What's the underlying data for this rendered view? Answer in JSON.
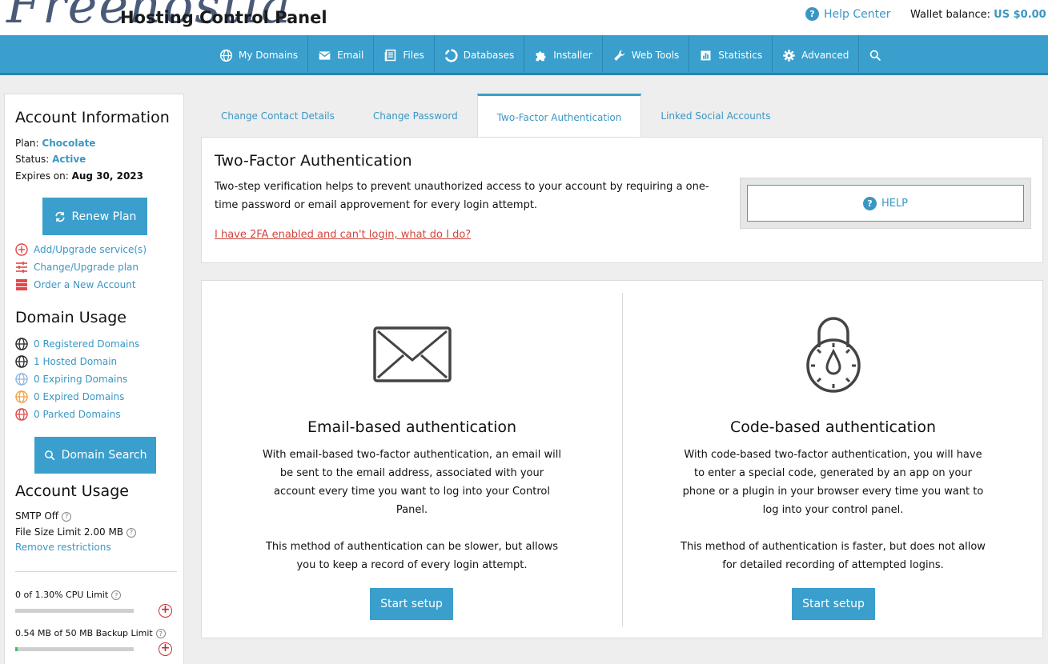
{
  "header": {
    "logo_script": "Freehostia",
    "logo_sub": "Hosting Control Panel",
    "help_center": "Help Center",
    "wallet_label": "Wallet balance:",
    "wallet_value": "US $0.00"
  },
  "nav": {
    "items": [
      {
        "label": "My Domains",
        "icon": "globe-icon"
      },
      {
        "label": "Email",
        "icon": "envelope-icon"
      },
      {
        "label": "Files",
        "icon": "files-icon"
      },
      {
        "label": "Databases",
        "icon": "database-icon"
      },
      {
        "label": "Installer",
        "icon": "puzzle-icon"
      },
      {
        "label": "Web Tools",
        "icon": "wrench-icon"
      },
      {
        "label": "Statistics",
        "icon": "chart-icon"
      },
      {
        "label": "Advanced",
        "icon": "gear-icon"
      }
    ],
    "search_icon": "search-icon"
  },
  "sidebar": {
    "account_info_title": "Account Information",
    "plan_label": "Plan:",
    "plan_value": "Chocolate",
    "status_label": "Status:",
    "status_value": "Active",
    "expires_label": "Expires on:",
    "expires_value": "Aug 30, 2023",
    "renew_button": "Renew Plan",
    "links": [
      "Add/Upgrade service(s)",
      "Change/Upgrade plan",
      "Order a New Account"
    ],
    "domain_usage_title": "Domain Usage",
    "domains": [
      {
        "label": "0 Registered Domains",
        "color": "#222222"
      },
      {
        "label": "1 Hosted Domain",
        "color": "#222222"
      },
      {
        "label": "0 Expiring Domains",
        "color": "#8fb6dc"
      },
      {
        "label": "0 Expired Domains",
        "color": "#f0a040"
      },
      {
        "label": "0 Parked Domains",
        "color": "#e04848"
      }
    ],
    "domain_search_button": "Domain Search",
    "account_usage_title": "Account Usage",
    "smtp": "SMTP Off",
    "file_size": "File Size Limit 2.00 MB",
    "remove_restrictions": "Remove restrictions",
    "cpu_limit": "0 of 1.30% CPU Limit",
    "cpu_fraction": 0.0,
    "backup_limit": "0.54 MB of 50 MB Backup Limit",
    "backup_fraction": 0.0108
  },
  "tabs": [
    {
      "label": "Change Contact Details",
      "active": false
    },
    {
      "label": "Change Password",
      "active": false
    },
    {
      "label": "Two-Factor Authentication",
      "active": true
    },
    {
      "label": "Linked Social Accounts",
      "active": false
    }
  ],
  "tfa": {
    "title": "Two-Factor Authentication",
    "description": "Two-step verification helps to prevent unauthorized access to your account by requiring a one-time password or email approvement for every login attempt.",
    "link": "I have 2FA enabled and can't login, what do I do?",
    "help_button": "HELP"
  },
  "methods": {
    "email": {
      "title": "Email-based authentication",
      "text1": "With email-based two-factor authentication, an email will be sent to the email address, associated with your account every time you want to log into your Control Panel.",
      "text2": "This method of authentication can be slower, but allows you to keep a record of every login attempt.",
      "button": "Start setup"
    },
    "code": {
      "title": "Code-based authentication",
      "text1": "With code-based two-factor authentication, you will have to enter a special code, generated by an app on your phone or a plugin in your browser every time you want to log into your control panel.",
      "text2": "This method of authentication is faster, but does not allow for detailed recording of attempted logins.",
      "button": "Start setup"
    }
  },
  "colors": {
    "accent": "#3a9fcc",
    "link": "#3a97c4",
    "danger_link": "#d0463c",
    "plus": "#c23030"
  }
}
